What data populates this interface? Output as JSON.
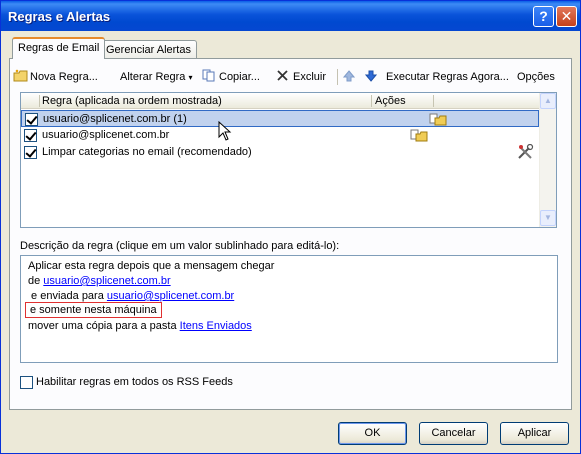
{
  "window": {
    "title": "Regras e Alertas",
    "help_glyph": "?",
    "close_glyph": "✕"
  },
  "tabs": [
    {
      "label": "Regras de Email",
      "active": true
    },
    {
      "label": "Gerenciar Alertas",
      "active": false
    }
  ],
  "toolbar": {
    "new_rule": "Nova Regra...",
    "change_rule": "Alterar Regra",
    "copy": "Copiar...",
    "delete": "Excluir",
    "move_up_icon": "arrow-up-icon",
    "move_down_icon": "arrow-down-icon",
    "run_rules": "Executar Regras Agora...",
    "options": "Opções"
  },
  "rules_list": {
    "columns": [
      "Regra (aplicada na ordem mostrada)",
      "Ações"
    ],
    "rows": [
      {
        "name": "usuario@splicenet.com.br (1)",
        "checked": true,
        "selected": true,
        "action_icon": "copy-to-folder-icon"
      },
      {
        "name": "usuario@splicenet.com.br",
        "checked": true,
        "selected": false,
        "action_icon": "copy-to-folder-icon"
      },
      {
        "name": "Limpar categorias no email (recomendado)",
        "checked": true,
        "selected": false,
        "action_icon": "tools-icon"
      }
    ]
  },
  "description": {
    "label": "Descrição da regra (clique em um valor sublinhado para editá-lo):",
    "line1": "Aplicar esta regra depois que a mensagem chegar",
    "line2_prefix": "de ",
    "line2_link": "usuario@splicenet.com.br",
    "line3_prefix": " e enviada para ",
    "line3_link": "usuario@splicenet.com.br",
    "line4": "e somente nesta máquina",
    "line5_prefix": "mover uma cópia para a pasta ",
    "line5_link": "Itens Enviados"
  },
  "rss": {
    "label": "Habilitar regras em todos os RSS Feeds",
    "checked": false
  },
  "buttons": {
    "ok": "OK",
    "cancel": "Cancelar",
    "apply": "Aplicar"
  },
  "colors": {
    "title_bar": "#0a53da",
    "selection": "#c1d2ee",
    "link": "#0000ff",
    "highlight_box": "#e03030"
  }
}
